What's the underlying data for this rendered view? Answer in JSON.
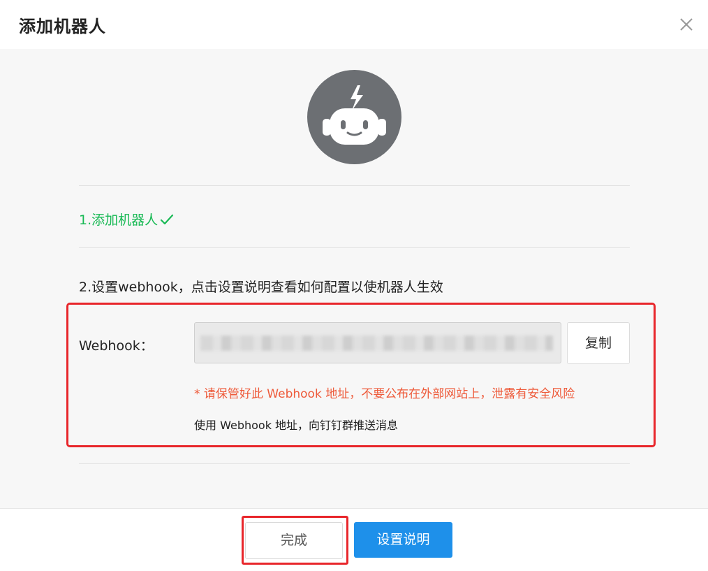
{
  "dialog": {
    "title": "添加机器人"
  },
  "steps": {
    "step1": "1.添加机器人",
    "step2": "2.设置webhook，点击设置说明查看如何配置以使机器人生效"
  },
  "webhook": {
    "label": "Webhook：",
    "value": "",
    "copy_label": "复制",
    "warning": "* 请保管好此 Webhook 地址，不要公布在外部网站上，泄露有安全风险",
    "usage": "使用 Webhook 地址，向钉钉群推送消息"
  },
  "footer": {
    "done_label": "完成",
    "help_label": "设置说明"
  },
  "colors": {
    "success": "#19b955",
    "warning": "#ee5a3a",
    "primary": "#1e90ea",
    "highlight": "#e8262b",
    "avatar_bg": "#6c6f73"
  },
  "icons": {
    "close": "close-icon",
    "robot": "robot-icon",
    "check": "check-icon"
  }
}
